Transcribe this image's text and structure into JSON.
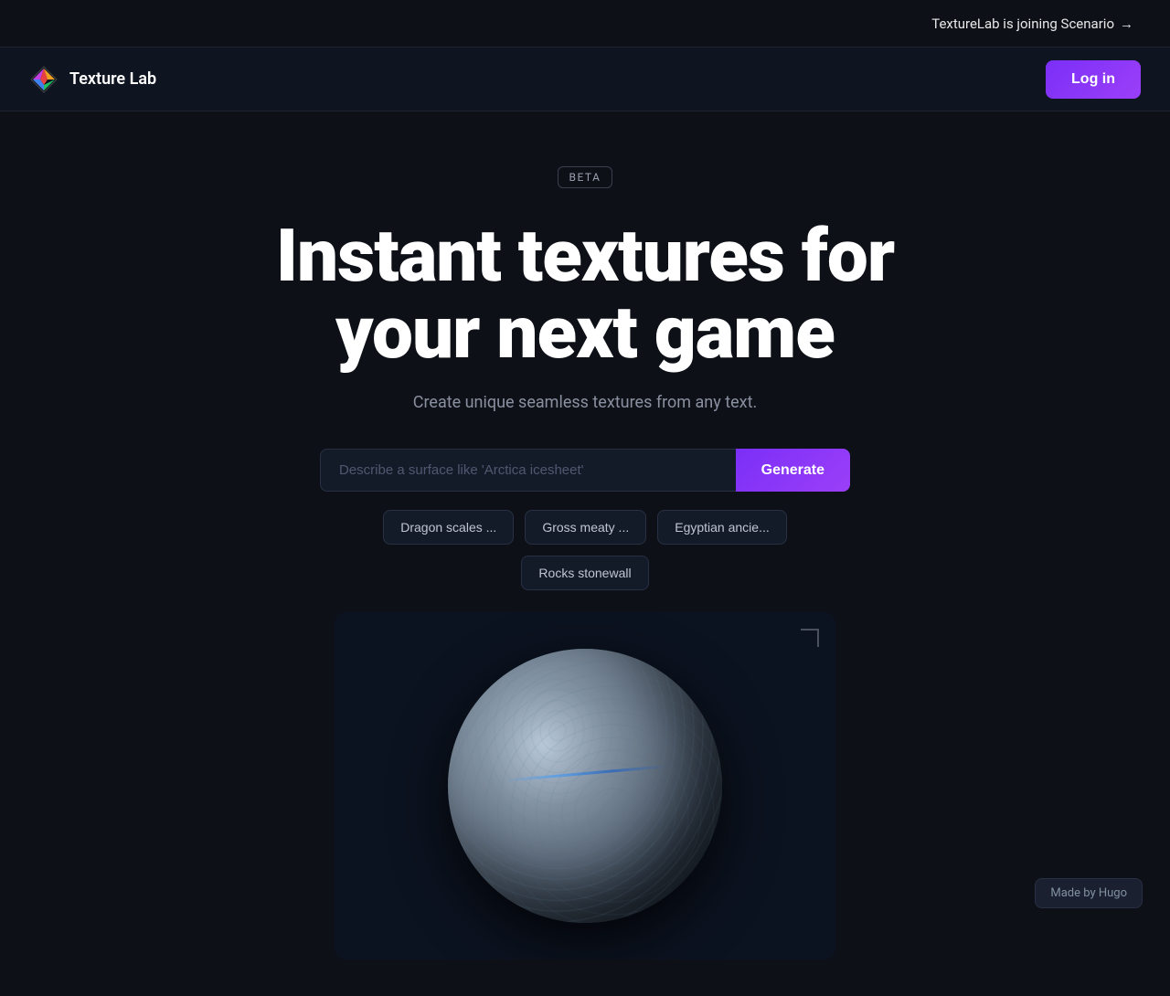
{
  "announcement": {
    "text": "TextureLab is joining Scenario",
    "arrow": "→"
  },
  "navbar": {
    "brand_name": "Texture Lab",
    "login_label": "Log in"
  },
  "hero": {
    "beta_label": "BETA",
    "title_line1": "Instant textures for",
    "title_line2": "your next game",
    "subtitle": "Create unique seamless textures from any text.",
    "input_placeholder": "Describe a surface like 'Arctica icesheet'",
    "generate_label": "Generate"
  },
  "chips": [
    {
      "label": "Dragon scales ..."
    },
    {
      "label": "Gross meaty ..."
    },
    {
      "label": "Egyptian ancie..."
    },
    {
      "label": "Rocks stonewall"
    }
  ],
  "footer": {
    "made_by": "Made by Hugo"
  }
}
